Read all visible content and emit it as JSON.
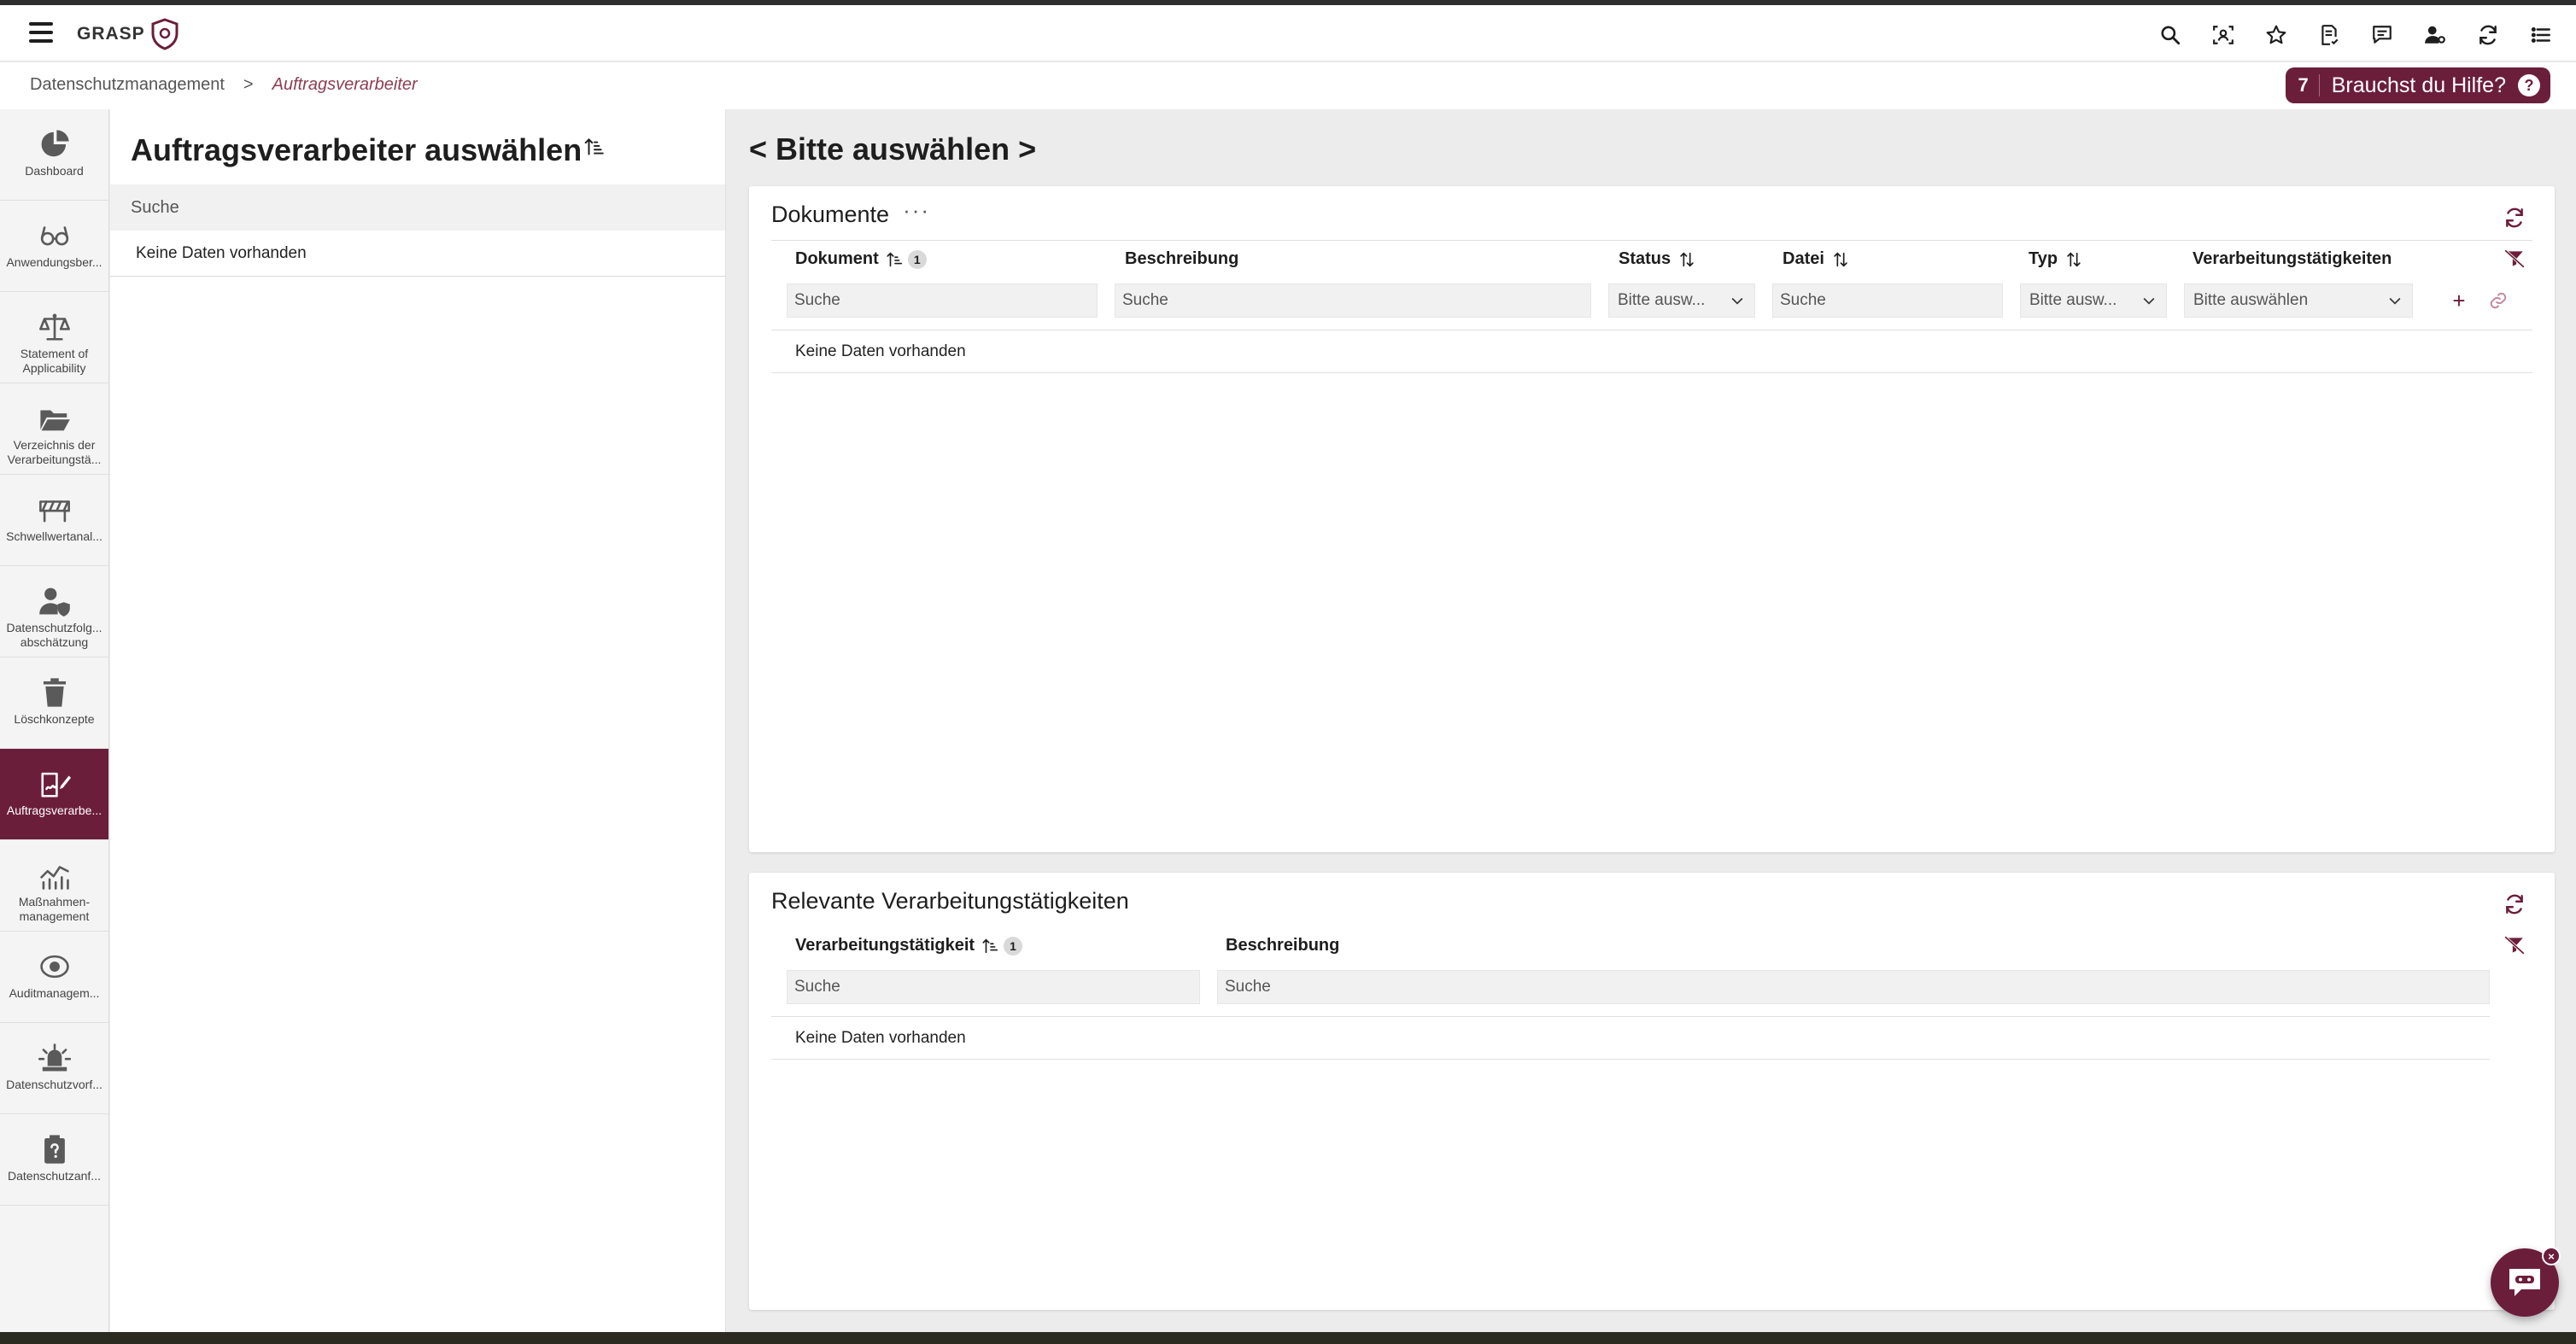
{
  "app": {
    "logo_text": "GRASP"
  },
  "topbar": {
    "icons": [
      "search-icon",
      "scan-face-icon",
      "star-icon",
      "document-check-icon",
      "chat-icon",
      "user-settings-icon",
      "refresh-icon",
      "list-icon"
    ]
  },
  "breadcrumb": {
    "root": "Datenschutzmanagement",
    "separator": ">",
    "current": "Auftragsverarbeiter"
  },
  "help": {
    "count": "7",
    "label": "Brauchst du Hilfe?",
    "icon_glyph": "?"
  },
  "sidebar": {
    "items": [
      {
        "label": "Dashboard",
        "icon": "pie-chart-icon",
        "active": false
      },
      {
        "label": "Anwendungsber...",
        "icon": "glasses-icon",
        "active": false
      },
      {
        "label": "Statement of Applicability",
        "icon": "balance-scale-icon",
        "active": false
      },
      {
        "label": "Verzeichnis der Verarbeitungstä...",
        "icon": "folder-open-icon",
        "active": false
      },
      {
        "label": "Schwellwertanal...",
        "icon": "barrier-icon",
        "active": false
      },
      {
        "label": "Datenschutzfolg... abschätzung",
        "icon": "user-shield-icon",
        "active": false
      },
      {
        "label": "Löschkonzepte",
        "icon": "trash-icon",
        "active": false
      },
      {
        "label": "Auftragsverarbe...",
        "icon": "signature-icon",
        "active": true
      },
      {
        "label": "Maßnahmen-management",
        "icon": "line-chart-icon",
        "active": false
      },
      {
        "label": "Auditmanagem...",
        "icon": "eye-icon",
        "active": false
      },
      {
        "label": "Datenschutzvorf...",
        "icon": "siren-icon",
        "active": false
      },
      {
        "label": "Datenschutzanf...",
        "icon": "clipboard-question-icon",
        "active": false
      }
    ]
  },
  "left_panel": {
    "title": "Auftragsverarbeiter auswählen",
    "search_placeholder": "Suche",
    "empty_text": "Keine Daten vorhanden"
  },
  "right_panel": {
    "title": "< Bitte auswählen >",
    "documents": {
      "title": "Dokumente",
      "menu_glyph": "···",
      "columns": [
        {
          "label": "Dokument",
          "sort_badge": "1"
        },
        {
          "label": "Beschreibung"
        },
        {
          "label": "Status"
        },
        {
          "label": "Datei"
        },
        {
          "label": "Typ"
        },
        {
          "label": "Verarbeitungstätigkeiten"
        }
      ],
      "filters": {
        "dokument_placeholder": "Suche",
        "beschreibung_placeholder": "Suche",
        "status_value": "Bitte ausw...",
        "datei_placeholder": "Suche",
        "typ_value": "Bitte ausw...",
        "verarbeitung_value": "Bitte auswählen"
      },
      "add_glyph": "+",
      "empty_text": "Keine Daten vorhanden"
    },
    "relevant": {
      "title": "Relevante Verarbeitungstätigkeiten",
      "columns": [
        {
          "label": "Verarbeitungstätigkeit",
          "sort_badge": "1"
        },
        {
          "label": "Beschreibung"
        }
      ],
      "filters": {
        "verarbeitung_placeholder": "Suche",
        "beschreibung_placeholder": "Suche"
      },
      "empty_text": "Keine Daten vorhanden"
    }
  },
  "chat": {
    "close_glyph": "×"
  },
  "colors": {
    "accent": "#6b1e3a",
    "breadcrumb_current": "#8b3e55"
  }
}
